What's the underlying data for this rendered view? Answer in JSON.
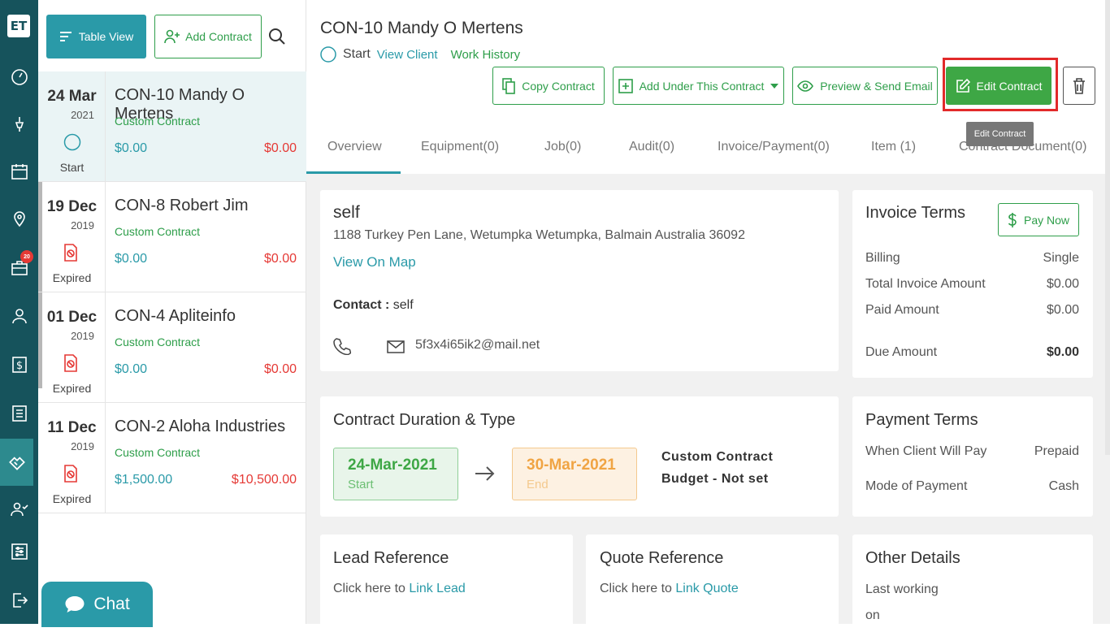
{
  "rail": {
    "logo": "ET",
    "badge_count": "20",
    "icons": [
      "dashboard-icon",
      "pen-tool-icon",
      "calendar-icon",
      "map-pin-icon",
      "briefcase-icon",
      "user-icon",
      "dollar-icon",
      "list-icon",
      "contract-icon",
      "users-icon",
      "settings-list-icon",
      "logout-icon"
    ]
  },
  "list": {
    "table_view_label": "Table View",
    "add_contract_label": "Add Contract",
    "items": [
      {
        "day": "24 Mar",
        "year": "2021",
        "status": "Start",
        "title": "CON-10 Mandy O Mertens",
        "type": "Custom Contract",
        "amount1": "$0.00",
        "amount2": "$0.00"
      },
      {
        "day": "19 Dec",
        "year": "2019",
        "status": "Expired",
        "title": "CON-8 Robert Jim",
        "type": "Custom Contract",
        "amount1": "$0.00",
        "amount2": "$0.00"
      },
      {
        "day": "01 Dec",
        "year": "2019",
        "status": "Expired",
        "title": "CON-4 Apliteinfo",
        "type": "Custom Contract",
        "amount1": "$0.00",
        "amount2": "$0.00"
      },
      {
        "day": "11 Dec",
        "year": "2019",
        "status": "Expired",
        "title": "CON-2 Aloha Industries",
        "type": "Custom Contract",
        "amount1": "$1,500.00",
        "amount2": "$10,500.00"
      }
    ],
    "chat_label": "Chat"
  },
  "header": {
    "title": "CON-10 Mandy O Mertens",
    "status": "Start",
    "view_client": "View Client",
    "work_history": "Work History",
    "copy_contract": "Copy Contract",
    "add_under": "Add Under This Contract",
    "preview_send": "Preview & Send Email",
    "edit_contract": "Edit Contract",
    "tooltip": "Edit Contract"
  },
  "tabs": [
    "Overview",
    "Equipment(0)",
    "Job(0)",
    "Audit(0)",
    "Invoice/Payment(0)",
    "Item (1)",
    "Contract Document(0)"
  ],
  "client": {
    "name": "self",
    "address": "1188 Turkey Pen Lane, Wetumpka Wetumpka, Balmain Australia 36092",
    "view_on_map": "View On Map",
    "contact_label": "Contact :",
    "contact_value": "self",
    "email": "5f3x4i65ik2@mail.net"
  },
  "invoice_terms": {
    "title": "Invoice Terms",
    "pay_now": "Pay Now",
    "billing_label": "Billing",
    "billing_value": "Single",
    "total_label": "Total Invoice Amount",
    "total_value": "$0.00",
    "paid_label": "Paid Amount",
    "paid_value": "$0.00",
    "due_label": "Due Amount",
    "due_value": "$0.00"
  },
  "duration": {
    "title": "Contract Duration & Type",
    "start_date": "24-Mar-2021",
    "start_label": "Start",
    "end_date": "30-Mar-2021",
    "end_label": "End",
    "type": "Custom Contract",
    "budget": "Budget - Not set"
  },
  "payment_terms": {
    "title": "Payment Terms",
    "when_label": "When Client Will Pay",
    "when_value": "Prepaid",
    "mode_label": "Mode of Payment",
    "mode_value": "Cash"
  },
  "lead": {
    "title": "Lead Reference",
    "prefix": "Click here to",
    "link": "Link Lead"
  },
  "quote": {
    "title": "Quote Reference",
    "prefix": "Click here to",
    "link": "Link Quote"
  },
  "other": {
    "title": "Other Details",
    "line1": "Last working",
    "line2": "on"
  },
  "colors": {
    "teal": "#2a9aa8",
    "green": "#2e9e4a",
    "rail": "#16535c",
    "red": "#e53935",
    "orange": "#f0a443"
  }
}
